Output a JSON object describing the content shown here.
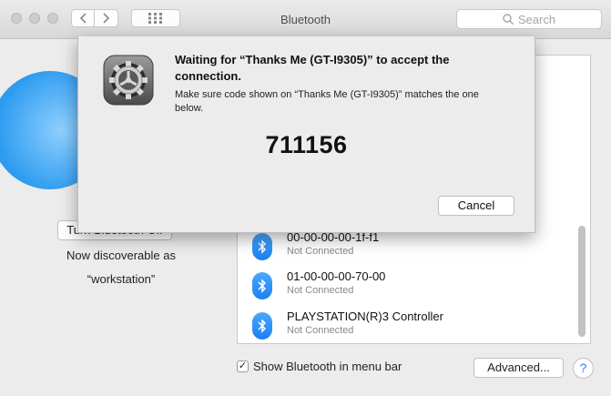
{
  "window": {
    "title": "Bluetooth"
  },
  "toolbar": {
    "search_placeholder": "Search"
  },
  "sidebar": {
    "turn_off_label": "Turn Bluetooth Off",
    "discoverable_line1": "Now discoverable as",
    "discoverable_line2": "“workstation”"
  },
  "devices": [
    {
      "name": "00-00-00-00-1f-f1",
      "status": "Not Connected"
    },
    {
      "name": "01-00-00-00-70-00",
      "status": "Not Connected"
    },
    {
      "name": "PLAYSTATION(R)3 Controller",
      "status": "Not Connected"
    }
  ],
  "footer": {
    "show_in_menu_bar_label": "Show Bluetooth in menu bar",
    "show_in_menu_bar_checked": true,
    "advanced_label": "Advanced...",
    "help_label": "?"
  },
  "dialog": {
    "title": "Waiting for “Thanks Me (GT-I9305)” to accept the connection.",
    "message": "Make sure code shown on “Thanks Me (GT-I9305)” matches the one below.",
    "code": "711156",
    "cancel_label": "Cancel"
  },
  "colors": {
    "accent": "#2d8cf0",
    "sheet_bg": "#ececec"
  }
}
